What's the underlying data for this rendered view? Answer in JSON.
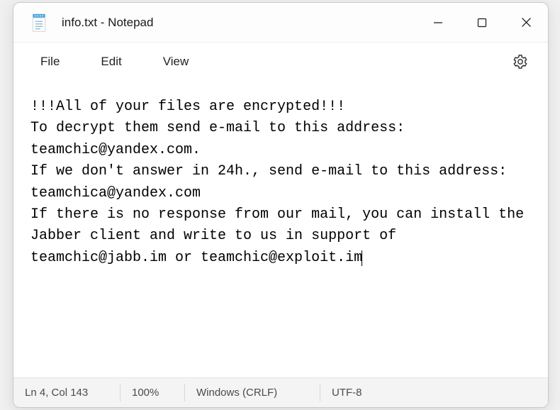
{
  "window": {
    "title": "info.txt - Notepad"
  },
  "menubar": {
    "file": "File",
    "edit": "Edit",
    "view": "View"
  },
  "document": {
    "text": "!!!All of your files are encrypted!!!\nTo decrypt them send e-mail to this address: teamchic@yandex.com.\nIf we don't answer in 24h., send e-mail to this address: teamchica@yandex.com\nIf there is no response from our mail, you can install the Jabber client and write to us in support of teamchic@jabb.im or teamchic@exploit.im"
  },
  "statusbar": {
    "position": "Ln 4, Col 143",
    "zoom": "100%",
    "line_ending": "Windows (CRLF)",
    "encoding": "UTF-8"
  }
}
